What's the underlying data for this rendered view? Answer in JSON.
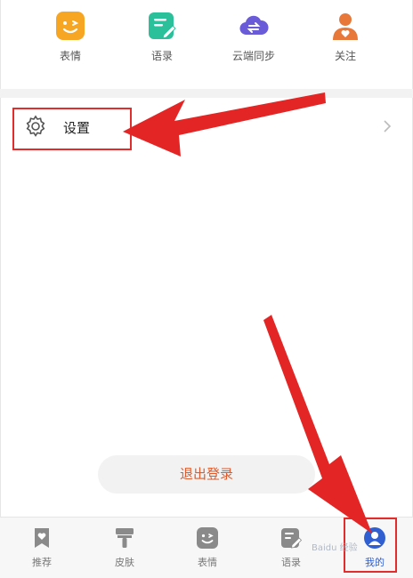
{
  "quick": [
    {
      "label": "表情"
    },
    {
      "label": "语录"
    },
    {
      "label": "云端同步"
    },
    {
      "label": "关注"
    }
  ],
  "settings": {
    "label": "设置"
  },
  "logout": {
    "label": "退出登录"
  },
  "tabs": [
    {
      "label": "推荐"
    },
    {
      "label": "皮肤"
    },
    {
      "label": "表情"
    },
    {
      "label": "语录"
    },
    {
      "label": "我的"
    }
  ],
  "watermark": {
    "text": "Baidu 经验"
  },
  "colors": {
    "highlight": "#e32d2d",
    "accent_active": "#2f5fd0",
    "logout_text": "#e05a2b"
  },
  "icons": {
    "quick": [
      "emoji-face-icon",
      "quote-note-icon",
      "cloud-sync-icon",
      "follow-user-icon"
    ],
    "settings": "gear-icon",
    "tabs": [
      "recommend-bookmark-icon",
      "skin-brush-icon",
      "emoji-face-icon",
      "quote-note-icon",
      "profile-user-icon"
    ]
  }
}
